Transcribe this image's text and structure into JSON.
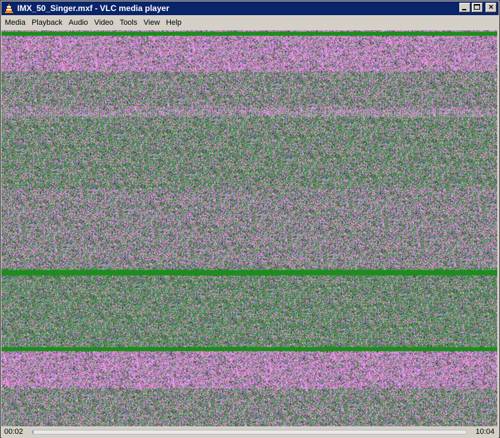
{
  "window": {
    "title": "IMX_50_Singer.mxf - VLC media player"
  },
  "title_buttons": {
    "minimize": "minimize-icon",
    "maximize": "maximize-icon",
    "close": "close-icon"
  },
  "menu": {
    "items": [
      "Media",
      "Playback",
      "Audio",
      "Video",
      "Tools",
      "View",
      "Help"
    ]
  },
  "video": {
    "content": "corrupted-video-frame",
    "colors": {
      "magenta": "#d47ad4",
      "green": "#3a8a3a",
      "bright_green": "#1e8c1e",
      "noise_dark": "#4a4a6a"
    }
  },
  "playback": {
    "elapsed": "00:02",
    "total": "10:04",
    "progress_fraction": 0.003
  },
  "colors": {
    "titlebar": "#0a246a",
    "chrome": "#d4d0c8"
  }
}
